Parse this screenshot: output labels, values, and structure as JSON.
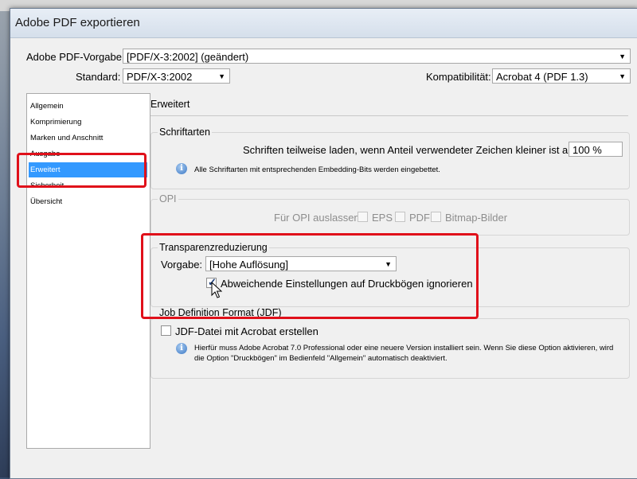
{
  "dialog": {
    "title": "Adobe PDF exportieren"
  },
  "preset": {
    "label": "Adobe PDF-Vorgabe:",
    "value": "[PDF/X-3:2002] (geändert)"
  },
  "standard": {
    "label": "Standard:",
    "value": "PDF/X-3:2002"
  },
  "compat": {
    "label": "Kompatibilität:",
    "value": "Acrobat 4 (PDF 1.3)"
  },
  "sidebar": {
    "items": [
      {
        "label": "Allgemein"
      },
      {
        "label": "Komprimierung"
      },
      {
        "label": "Marken und Anschnitt"
      },
      {
        "label": "Ausgabe"
      },
      {
        "label": "Erweitert"
      },
      {
        "label": "Sicherheit"
      },
      {
        "label": "Übersicht"
      }
    ],
    "selected": "Erweitert"
  },
  "panel": {
    "title": "Erweitert"
  },
  "fonts": {
    "group_label": "Schriftarten",
    "subset_label": "Schriften teilweise laden, wenn Anteil verwendeter Zeichen kleiner ist als:",
    "subset_value": "100 %",
    "info": "Alle Schriftarten mit entsprechenden Embedding-Bits werden eingebettet."
  },
  "opi": {
    "group_label": "OPI",
    "omit_label": "Für OPI auslassen:",
    "eps": "EPS",
    "pdf": "PDF",
    "bitmap": "Bitmap-Bilder"
  },
  "flatten": {
    "group_label": "Transparenzreduzierung",
    "preset_label": "Vorgabe:",
    "preset_value": "[Hohe Auflösung]",
    "ignore_label": "Abweichende Einstellungen auf Druckbögen ignorieren",
    "ignore_checked": true
  },
  "jdf": {
    "group_label": "Job Definition Format (JDF)",
    "create_label": "JDF-Datei mit Acrobat erstellen",
    "info_line1": "Hierfür muss Adobe Acrobat 7.0 Professional oder eine neuere Version installiert sein. Wenn Sie diese Option aktivieren, wird",
    "info_line2": "die Option \"Druckbögen\" im Bedienfeld \"Allgemein\" automatisch deaktiviert."
  },
  "colors": {
    "highlight": "#e0101a",
    "selection": "#3399ff"
  },
  "icons": [
    "info-icon",
    "chevron-down-icon",
    "checkmark-icon",
    "mouse-cursor-icon"
  ]
}
